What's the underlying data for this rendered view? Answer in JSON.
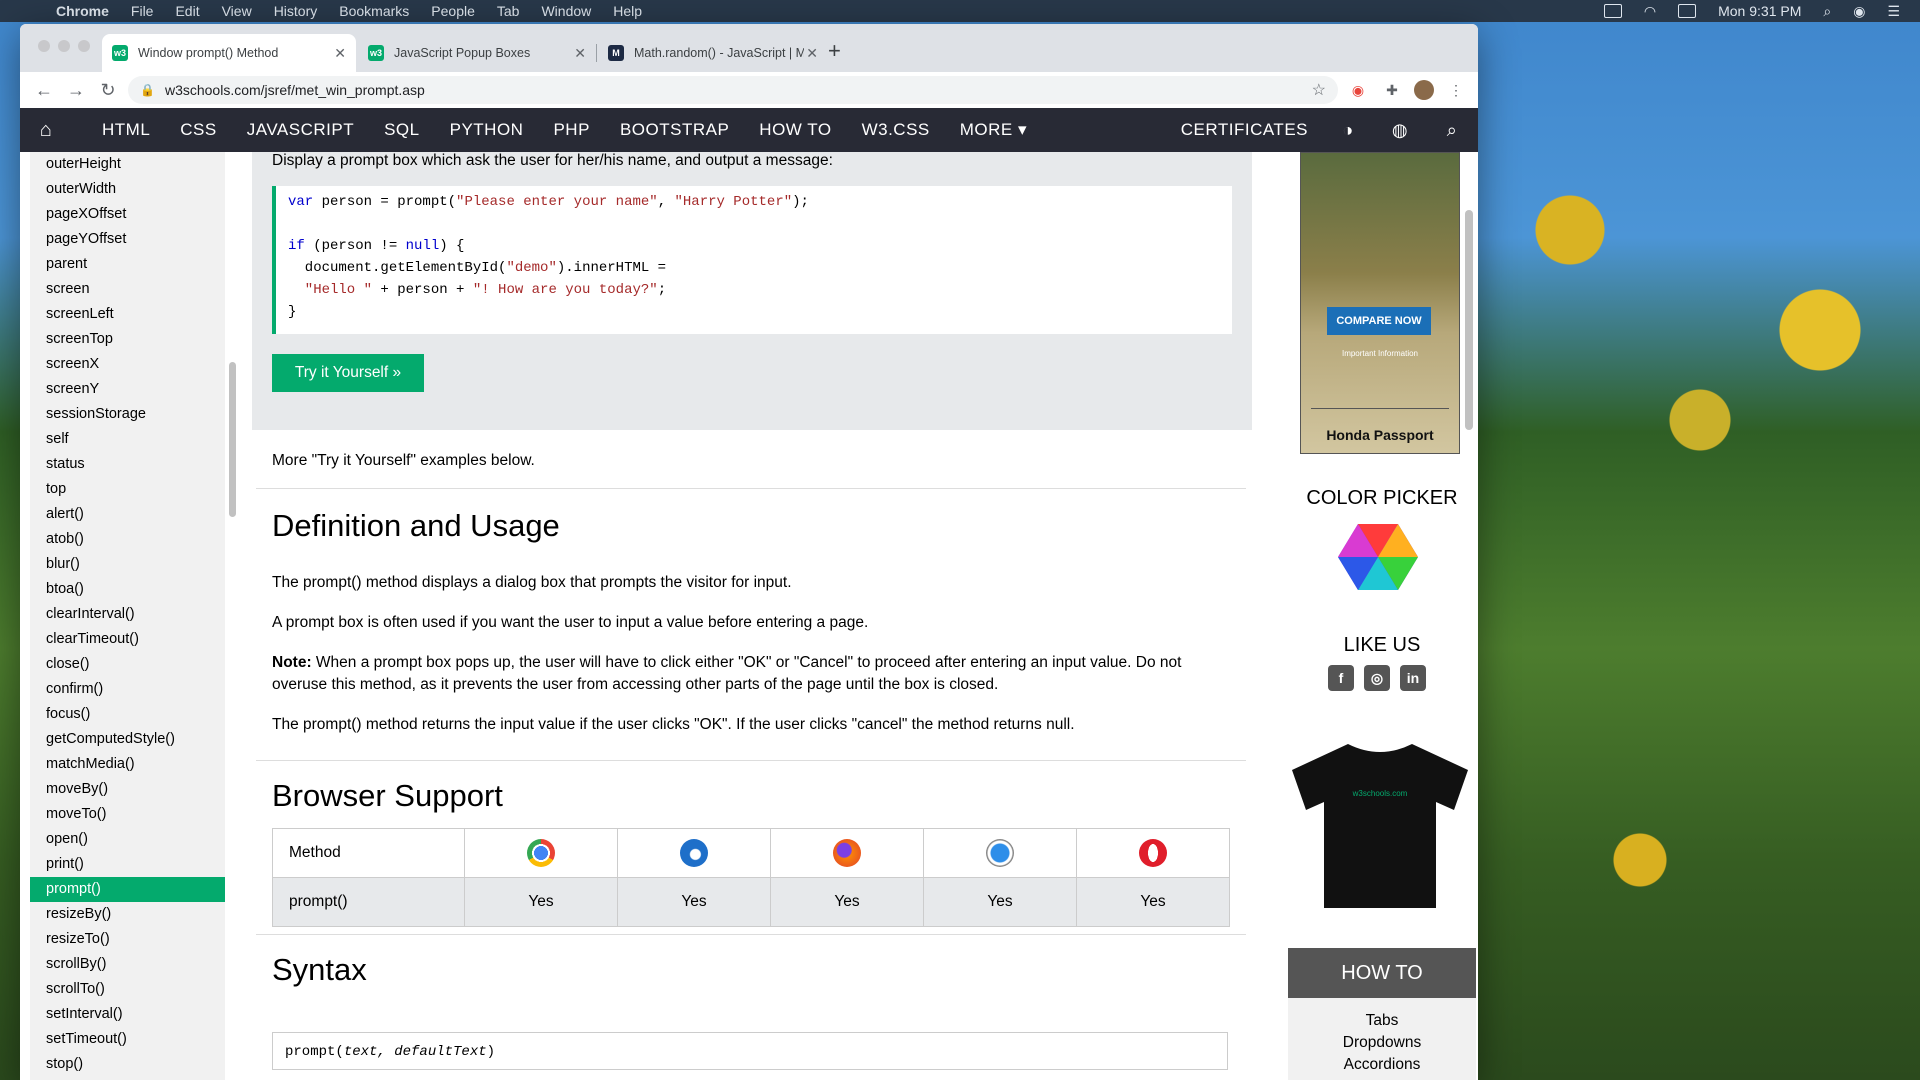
{
  "menubar": {
    "app_name": "Chrome",
    "menus": [
      "File",
      "Edit",
      "View",
      "History",
      "Bookmarks",
      "People",
      "Tab",
      "Window",
      "Help"
    ],
    "clock": "Mon 9:31 PM"
  },
  "tabs": [
    {
      "label": "Window prompt() Method",
      "favicon": "w3",
      "active": true
    },
    {
      "label": "JavaScript Popup Boxes",
      "favicon": "w3",
      "active": false
    },
    {
      "label": "Math.random() - JavaScript | M",
      "favicon": "mdn",
      "active": false
    }
  ],
  "address": {
    "url": "w3schools.com/jsref/met_win_prompt.asp"
  },
  "topnav": {
    "items": [
      "HTML",
      "CSS",
      "JAVASCRIPT",
      "SQL",
      "PYTHON",
      "PHP",
      "BOOTSTRAP",
      "HOW TO",
      "W3.CSS",
      "MORE ▾"
    ],
    "certificates": "CERTIFICATES"
  },
  "sidebar": {
    "items": [
      "outerHeight",
      "outerWidth",
      "pageXOffset",
      "pageYOffset",
      "parent",
      "screen",
      "screenLeft",
      "screenTop",
      "screenX",
      "screenY",
      "sessionStorage",
      "self",
      "status",
      "top",
      "alert()",
      "atob()",
      "blur()",
      "btoa()",
      "clearInterval()",
      "clearTimeout()",
      "close()",
      "confirm()",
      "focus()",
      "getComputedStyle()",
      "matchMedia()",
      "moveBy()",
      "moveTo()",
      "open()",
      "print()",
      "prompt()",
      "resizeBy()",
      "resizeTo()",
      "scrollBy()",
      "scrollTo()",
      "setInterval()",
      "setTimeout()",
      "stop()"
    ],
    "active": "prompt()"
  },
  "example": {
    "lead": "Display a prompt box which ask the user for her/his name, and output a message:",
    "code": {
      "l1_kw": "var",
      "l1_a": " person = prompt(",
      "l1_s1": "\"Please enter your name\"",
      "l1_b": ", ",
      "l1_s2": "\"Harry Potter\"",
      "l1_c": ");",
      "l2_kw": "if",
      "l2_a": " (person != ",
      "l2_null": "null",
      "l2_b": ") {",
      "l3_a": "  document.getElementById(",
      "l3_s": "\"demo\"",
      "l3_b": ").innerHTML =",
      "l4_s1": "  \"Hello \"",
      "l4_a": " + person + ",
      "l4_s2": "\"! How are you today?\"",
      "l4_b": ";",
      "l5": "}"
    },
    "try_button": "Try it Yourself »"
  },
  "more_examples": "More \"Try it Yourself\" examples below.",
  "definition": {
    "heading": "Definition and Usage",
    "p1": "The prompt() method displays a dialog box that prompts the visitor for input.",
    "p2": "A prompt box is often used if you want the user to input a value before entering a page.",
    "note_label": "Note:",
    "note_text": " When a prompt box pops up, the user will have to click either \"OK\" or \"Cancel\" to proceed after entering an input value. Do not overuse this method, as it prevents the user from accessing other parts of the page until the box is closed.",
    "p4": "The prompt() method returns the input value if the user clicks \"OK\". If the user clicks \"cancel\" the method returns null."
  },
  "browser_support": {
    "heading": "Browser Support",
    "method_header": "Method",
    "browsers": [
      "chrome-icon",
      "edge-icon",
      "firefox-icon",
      "safari-icon",
      "opera-icon"
    ],
    "row_method": "prompt()",
    "values": [
      "Yes",
      "Yes",
      "Yes",
      "Yes",
      "Yes"
    ]
  },
  "syntax": {
    "heading": "Syntax",
    "code_fn": "prompt(",
    "code_args": "text, defaultText",
    "code_end": ")"
  },
  "right_column": {
    "ad_cta": "COMPARE NOW",
    "ad_small": "Important Information",
    "ad_model": "Honda Passport",
    "color_picker": "COLOR PICKER",
    "like_us": "LIKE US",
    "shirt_brand": "w3schools.com",
    "howto_heading": "HOW TO",
    "howto_items": [
      "Tabs",
      "Dropdowns",
      "Accordions"
    ]
  },
  "colors": {
    "accent": "#04aa6d",
    "nav": "#282a35",
    "code_keyword": "#0000cd",
    "code_string": "#a52a2a"
  }
}
